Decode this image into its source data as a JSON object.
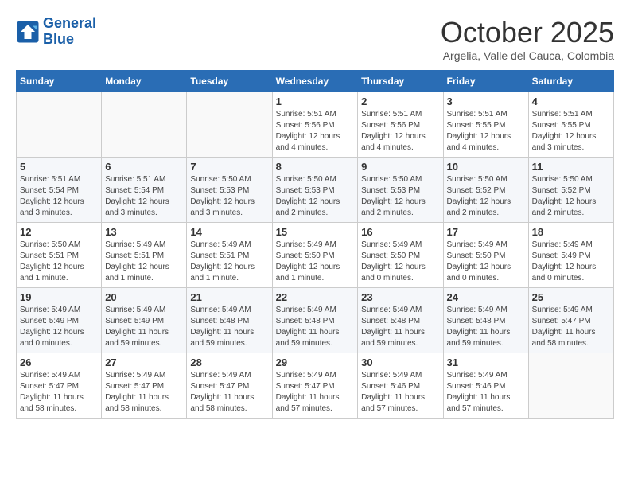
{
  "header": {
    "logo_line1": "General",
    "logo_line2": "Blue",
    "month": "October 2025",
    "location": "Argelia, Valle del Cauca, Colombia"
  },
  "weekdays": [
    "Sunday",
    "Monday",
    "Tuesday",
    "Wednesday",
    "Thursday",
    "Friday",
    "Saturday"
  ],
  "weeks": [
    [
      {
        "day": "",
        "info": ""
      },
      {
        "day": "",
        "info": ""
      },
      {
        "day": "",
        "info": ""
      },
      {
        "day": "1",
        "info": "Sunrise: 5:51 AM\nSunset: 5:56 PM\nDaylight: 12 hours\nand 4 minutes."
      },
      {
        "day": "2",
        "info": "Sunrise: 5:51 AM\nSunset: 5:56 PM\nDaylight: 12 hours\nand 4 minutes."
      },
      {
        "day": "3",
        "info": "Sunrise: 5:51 AM\nSunset: 5:55 PM\nDaylight: 12 hours\nand 4 minutes."
      },
      {
        "day": "4",
        "info": "Sunrise: 5:51 AM\nSunset: 5:55 PM\nDaylight: 12 hours\nand 3 minutes."
      }
    ],
    [
      {
        "day": "5",
        "info": "Sunrise: 5:51 AM\nSunset: 5:54 PM\nDaylight: 12 hours\nand 3 minutes."
      },
      {
        "day": "6",
        "info": "Sunrise: 5:51 AM\nSunset: 5:54 PM\nDaylight: 12 hours\nand 3 minutes."
      },
      {
        "day": "7",
        "info": "Sunrise: 5:50 AM\nSunset: 5:53 PM\nDaylight: 12 hours\nand 3 minutes."
      },
      {
        "day": "8",
        "info": "Sunrise: 5:50 AM\nSunset: 5:53 PM\nDaylight: 12 hours\nand 2 minutes."
      },
      {
        "day": "9",
        "info": "Sunrise: 5:50 AM\nSunset: 5:53 PM\nDaylight: 12 hours\nand 2 minutes."
      },
      {
        "day": "10",
        "info": "Sunrise: 5:50 AM\nSunset: 5:52 PM\nDaylight: 12 hours\nand 2 minutes."
      },
      {
        "day": "11",
        "info": "Sunrise: 5:50 AM\nSunset: 5:52 PM\nDaylight: 12 hours\nand 2 minutes."
      }
    ],
    [
      {
        "day": "12",
        "info": "Sunrise: 5:50 AM\nSunset: 5:51 PM\nDaylight: 12 hours\nand 1 minute."
      },
      {
        "day": "13",
        "info": "Sunrise: 5:49 AM\nSunset: 5:51 PM\nDaylight: 12 hours\nand 1 minute."
      },
      {
        "day": "14",
        "info": "Sunrise: 5:49 AM\nSunset: 5:51 PM\nDaylight: 12 hours\nand 1 minute."
      },
      {
        "day": "15",
        "info": "Sunrise: 5:49 AM\nSunset: 5:50 PM\nDaylight: 12 hours\nand 1 minute."
      },
      {
        "day": "16",
        "info": "Sunrise: 5:49 AM\nSunset: 5:50 PM\nDaylight: 12 hours\nand 0 minutes."
      },
      {
        "day": "17",
        "info": "Sunrise: 5:49 AM\nSunset: 5:50 PM\nDaylight: 12 hours\nand 0 minutes."
      },
      {
        "day": "18",
        "info": "Sunrise: 5:49 AM\nSunset: 5:49 PM\nDaylight: 12 hours\nand 0 minutes."
      }
    ],
    [
      {
        "day": "19",
        "info": "Sunrise: 5:49 AM\nSunset: 5:49 PM\nDaylight: 12 hours\nand 0 minutes."
      },
      {
        "day": "20",
        "info": "Sunrise: 5:49 AM\nSunset: 5:49 PM\nDaylight: 11 hours\nand 59 minutes."
      },
      {
        "day": "21",
        "info": "Sunrise: 5:49 AM\nSunset: 5:48 PM\nDaylight: 11 hours\nand 59 minutes."
      },
      {
        "day": "22",
        "info": "Sunrise: 5:49 AM\nSunset: 5:48 PM\nDaylight: 11 hours\nand 59 minutes."
      },
      {
        "day": "23",
        "info": "Sunrise: 5:49 AM\nSunset: 5:48 PM\nDaylight: 11 hours\nand 59 minutes."
      },
      {
        "day": "24",
        "info": "Sunrise: 5:49 AM\nSunset: 5:48 PM\nDaylight: 11 hours\nand 59 minutes."
      },
      {
        "day": "25",
        "info": "Sunrise: 5:49 AM\nSunset: 5:47 PM\nDaylight: 11 hours\nand 58 minutes."
      }
    ],
    [
      {
        "day": "26",
        "info": "Sunrise: 5:49 AM\nSunset: 5:47 PM\nDaylight: 11 hours\nand 58 minutes."
      },
      {
        "day": "27",
        "info": "Sunrise: 5:49 AM\nSunset: 5:47 PM\nDaylight: 11 hours\nand 58 minutes."
      },
      {
        "day": "28",
        "info": "Sunrise: 5:49 AM\nSunset: 5:47 PM\nDaylight: 11 hours\nand 58 minutes."
      },
      {
        "day": "29",
        "info": "Sunrise: 5:49 AM\nSunset: 5:47 PM\nDaylight: 11 hours\nand 57 minutes."
      },
      {
        "day": "30",
        "info": "Sunrise: 5:49 AM\nSunset: 5:46 PM\nDaylight: 11 hours\nand 57 minutes."
      },
      {
        "day": "31",
        "info": "Sunrise: 5:49 AM\nSunset: 5:46 PM\nDaylight: 11 hours\nand 57 minutes."
      },
      {
        "day": "",
        "info": ""
      }
    ]
  ]
}
